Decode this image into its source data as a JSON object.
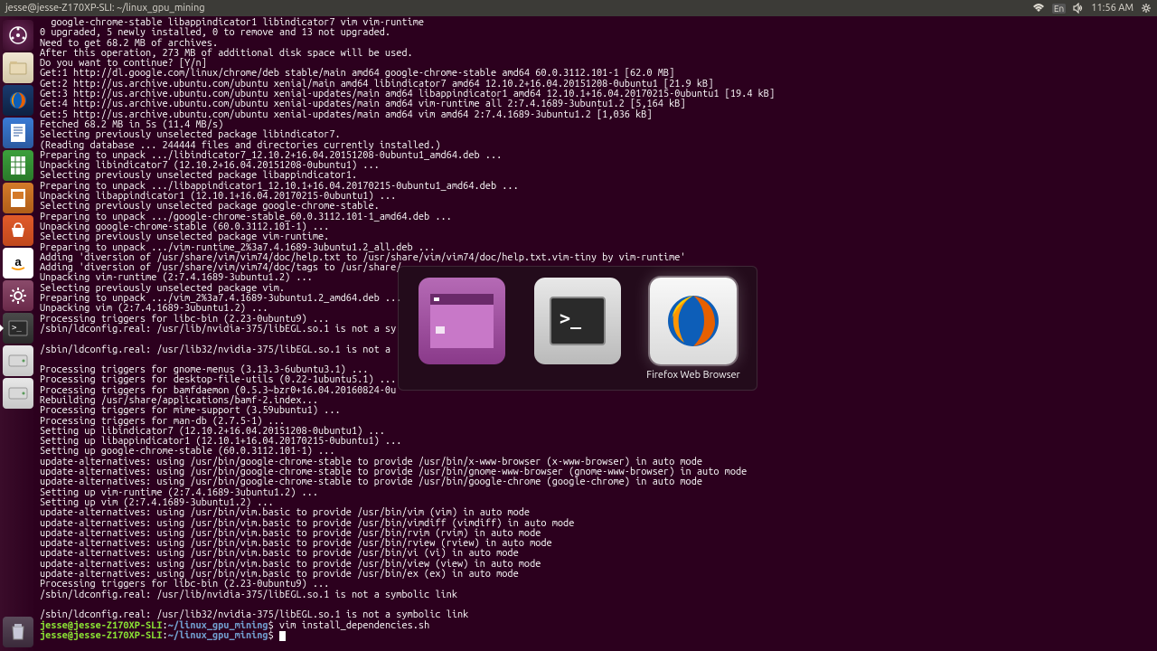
{
  "menubar": {
    "title": "jesse@jesse-Z170XP-SLI: ~/linux_gpu_mining",
    "time": "11:56 AM",
    "lang": "En"
  },
  "terminal": {
    "body": "  google-chrome-stable libappindicator1 libindicator7 vim vim-runtime\n0 upgraded, 5 newly installed, 0 to remove and 13 not upgraded.\nNeed to get 68.2 MB of archives.\nAfter this operation, 273 MB of additional disk space will be used.\nDo you want to continue? [Y/n]\nGet:1 http://dl.google.com/linux/chrome/deb stable/main amd64 google-chrome-stable amd64 60.0.3112.101-1 [62.0 MB]\nGet:2 http://us.archive.ubuntu.com/ubuntu xenial/main amd64 libindicator7 amd64 12.10.2+16.04.20151208-0ubuntu1 [21.9 kB]\nGet:3 http://us.archive.ubuntu.com/ubuntu xenial-updates/main amd64 libappindicator1 amd64 12.10.1+16.04.20170215-0ubuntu1 [19.4 kB]\nGet:4 http://us.archive.ubuntu.com/ubuntu xenial-updates/main amd64 vim-runtime all 2:7.4.1689-3ubuntu1.2 [5,164 kB]\nGet:5 http://us.archive.ubuntu.com/ubuntu xenial-updates/main amd64 vim amd64 2:7.4.1689-3ubuntu1.2 [1,036 kB]\nFetched 68.2 MB in 5s (11.4 MB/s)\nSelecting previously unselected package libindicator7.\n(Reading database ... 244444 files and directories currently installed.)\nPreparing to unpack .../libindicator7_12.10.2+16.04.20151208-0ubuntu1_amd64.deb ...\nUnpacking libindicator7 (12.10.2+16.04.20151208-0ubuntu1) ...\nSelecting previously unselected package libappindicator1.\nPreparing to unpack .../libappindicator1_12.10.1+16.04.20170215-0ubuntu1_amd64.deb ...\nUnpacking libappindicator1 (12.10.1+16.04.20170215-0ubuntu1) ...\nSelecting previously unselected package google-chrome-stable.\nPreparing to unpack .../google-chrome-stable_60.0.3112.101-1_amd64.deb ...\nUnpacking google-chrome-stable (60.0.3112.101-1) ...\nSelecting previously unselected package vim-runtime.\nPreparing to unpack .../vim-runtime_2%3a7.4.1689-3ubuntu1.2_all.deb ...\nAdding 'diversion of /usr/share/vim/vim74/doc/help.txt to /usr/share/vim/vim74/doc/help.txt.vim-tiny by vim-runtime'\nAdding 'diversion of /usr/share/vim/vim74/doc/tags to /usr/share/\nUnpacking vim-runtime (2:7.4.1689-3ubuntu1.2) ...\nSelecting previously unselected package vim.\nPreparing to unpack .../vim_2%3a7.4.1689-3ubuntu1.2_amd64.deb ...\nUnpacking vim (2:7.4.1689-3ubuntu1.2) ...\nProcessing triggers for libc-bin (2.23-0ubuntu9) ...\n/sbin/ldconfig.real: /usr/lib/nvidia-375/libEGL.so.1 is not a sy\n\n/sbin/ldconfig.real: /usr/lib32/nvidia-375/libEGL.so.1 is not a \n\nProcessing triggers for gnome-menus (3.13.3-6ubuntu3.1) ...\nProcessing triggers for desktop-file-utils (0.22-1ubuntu5.1) ...\nProcessing triggers for bamfdaemon (0.5.3~bzr0+16.04.20160824-0u\nRebuilding /usr/share/applications/bamf-2.index...\nProcessing triggers for mime-support (3.59ubuntu1) ...\nProcessing triggers for man-db (2.7.5-1) ...\nSetting up libindicator7 (12.10.2+16.04.20151208-0ubuntu1) ...\nSetting up libappindicator1 (12.10.1+16.04.20170215-0ubuntu1) ...\nSetting up google-chrome-stable (60.0.3112.101-1) ...\nupdate-alternatives: using /usr/bin/google-chrome-stable to provide /usr/bin/x-www-browser (x-www-browser) in auto mode\nupdate-alternatives: using /usr/bin/google-chrome-stable to provide /usr/bin/gnome-www-browser (gnome-www-browser) in auto mode\nupdate-alternatives: using /usr/bin/google-chrome-stable to provide /usr/bin/google-chrome (google-chrome) in auto mode\nSetting up vim-runtime (2:7.4.1689-3ubuntu1.2) ...\nSetting up vim (2:7.4.1689-3ubuntu1.2) ...\nupdate-alternatives: using /usr/bin/vim.basic to provide /usr/bin/vim (vim) in auto mode\nupdate-alternatives: using /usr/bin/vim.basic to provide /usr/bin/vimdiff (vimdiff) in auto mode\nupdate-alternatives: using /usr/bin/vim.basic to provide /usr/bin/rvim (rvim) in auto mode\nupdate-alternatives: using /usr/bin/vim.basic to provide /usr/bin/rview (rview) in auto mode\nupdate-alternatives: using /usr/bin/vim.basic to provide /usr/bin/vi (vi) in auto mode\nupdate-alternatives: using /usr/bin/vim.basic to provide /usr/bin/view (view) in auto mode\nupdate-alternatives: using /usr/bin/vim.basic to provide /usr/bin/ex (ex) in auto mode\nProcessing triggers for libc-bin (2.23-0ubuntu9) ...\n/sbin/ldconfig.real: /usr/lib/nvidia-375/libEGL.so.1 is not a symbolic link\n\n/sbin/ldconfig.real: /usr/lib32/nvidia-375/libEGL.so.1 is not a symbolic link\n",
    "prompt_user": "jesse@jesse-Z170XP-SLI",
    "prompt_path": "~/linux_gpu_mining",
    "prev_cmd": "vim install_dependencies.sh"
  },
  "switcher": {
    "apps": [
      {
        "label": ""
      },
      {
        "label": ""
      },
      {
        "label": "Firefox Web Browser"
      }
    ]
  }
}
